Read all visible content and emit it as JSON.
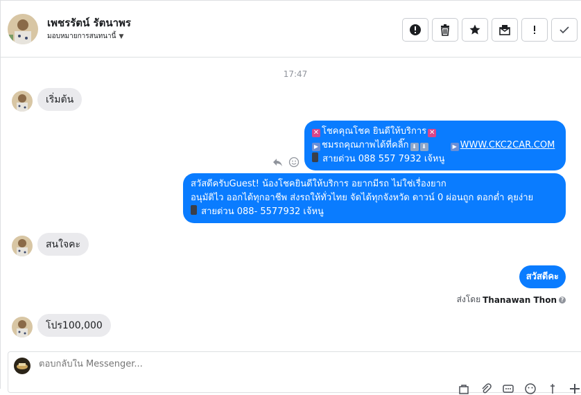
{
  "header": {
    "contact_name": "เพชรรัตน์ รัตนาพร",
    "assign_label": "มอบหมายการสนทนานี้",
    "toolbar": [
      {
        "icon": "alert-icon",
        "label": "Mark as spam"
      },
      {
        "icon": "trash-icon",
        "label": "Delete"
      },
      {
        "icon": "star-icon",
        "label": "Star"
      },
      {
        "icon": "mark-unread-icon",
        "label": "Mark unread"
      },
      {
        "icon": "exclamation-icon",
        "label": "Follow up"
      },
      {
        "icon": "check-icon",
        "label": "Done"
      }
    ]
  },
  "conversation": {
    "timestamp": "17:47",
    "messages": [
      {
        "direction": "in",
        "text": "เริ่มต้น"
      },
      {
        "direction": "out",
        "lines": [
          "โชคคุณโชค ยินดีให้บริการ",
          "ชมรถคุณภาพได้ที่คลิ๊ก",
          "สายด่วน 088 557 7932 เจ้หนู"
        ],
        "link": "WWW.CKC2CAR.COM"
      },
      {
        "direction": "out",
        "lines": [
          "สวัสดีครับGuest! น้องโชคยินดีให้บริการ อยากมีรถ ไม่ใช่เรื่องยาก",
          "อนุมัติไว ออกได้ทุกอาชีพ ส่งรถให้ทั่วไทย จัดได้ทุกจังหวัด ดาวน์ 0  ผ่อนถูก ดอกต่ำ คุยง่าย",
          "สายด่วน 088- 5577932 เจ้หนู"
        ]
      },
      {
        "direction": "in",
        "text": "สนใจคะ"
      },
      {
        "direction": "out",
        "text": "สวัสดีคะ"
      },
      {
        "direction": "in",
        "text": "โปร100,000"
      }
    ],
    "sent_by_prefix": "ส่งโดย",
    "sent_by_name": "Thanawan Thon"
  },
  "composer": {
    "placeholder": "ตอบกลับใน Messenger..."
  },
  "colors": {
    "outgoing_bubble": "#0a7cff",
    "incoming_bubble": "#eaeaed"
  }
}
